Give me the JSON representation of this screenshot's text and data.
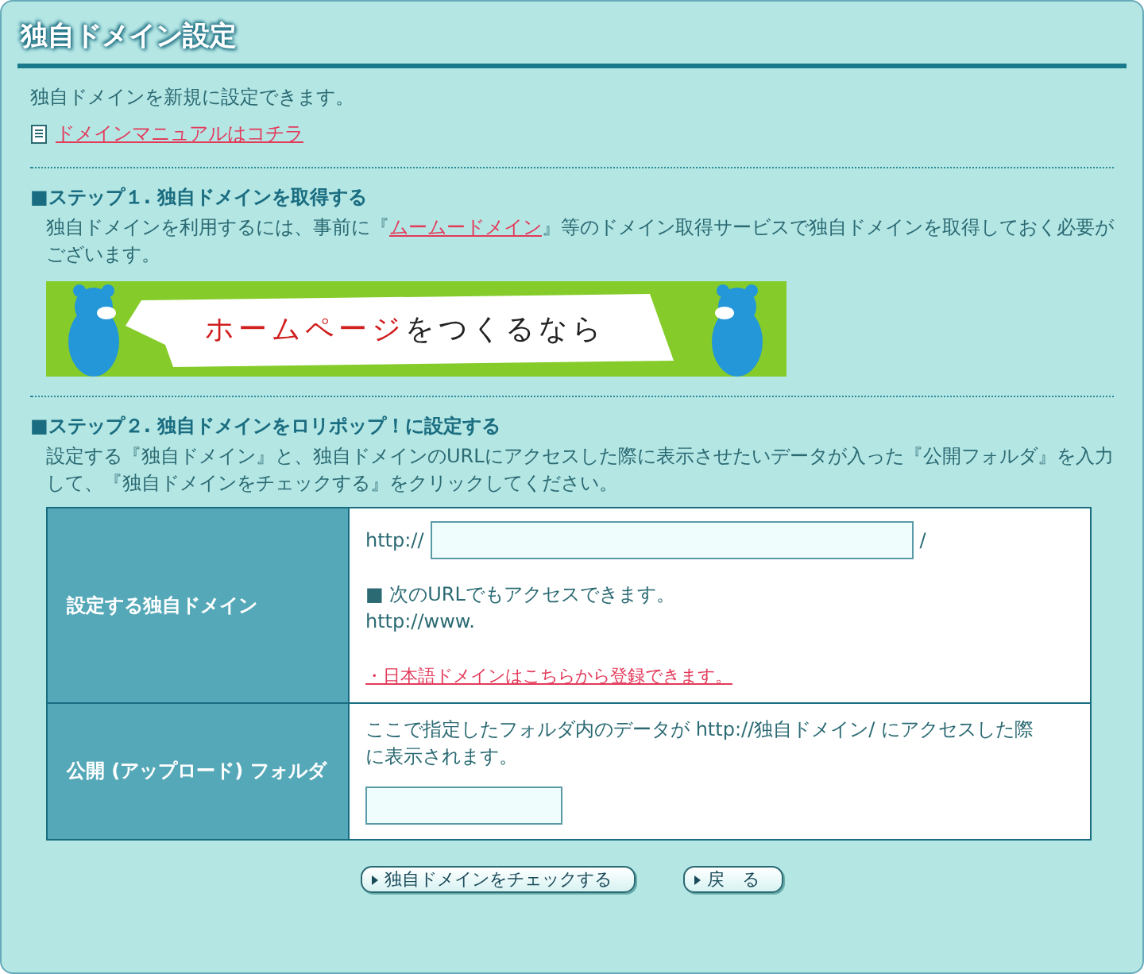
{
  "title": "独自ドメイン設定",
  "intro": "独自ドメインを新規に設定できます。",
  "manual_link": "ドメインマニュアルはコチラ",
  "step1": {
    "heading": "■ステップ１. 独自ドメインを取得する",
    "text_before": "独自ドメインを利用するには、事前に『",
    "link": "ムームードメイン",
    "text_after": "』等のドメイン取得サービスで独自ドメインを取得しておく必要がございます。"
  },
  "banner": {
    "kind": "picture",
    "accent_text": "ホームページ",
    "text": "をつくるなら"
  },
  "step2": {
    "heading": "■ステップ２. 独自ドメインをロリポップ！に設定する",
    "text": "設定する『独自ドメイン』と、独自ドメインのURLにアクセスした際に表示させたいデータが入った『公開フォルダ』を入力して、『独自ドメインをチェックする』をクリックしてください。"
  },
  "form": {
    "rows": [
      {
        "kind": "domain",
        "label": "設定する独自ドメイン",
        "prefix": "http://",
        "suffix": "/",
        "note": "■ 次のURLでもアクセスできます。",
        "www": "http://www.",
        "link": "・日本語ドメインはこちらから登録できます。"
      },
      {
        "kind": "folder",
        "label": "公開 (アップロード) フォルダ",
        "description": "ここで指定したフォルダ内のデータが http://独自ドメイン/ にアクセスした際に表示されます。"
      }
    ]
  },
  "buttons": [
    {
      "label": "独自ドメインをチェックする"
    },
    {
      "label": "戻　る"
    }
  ]
}
